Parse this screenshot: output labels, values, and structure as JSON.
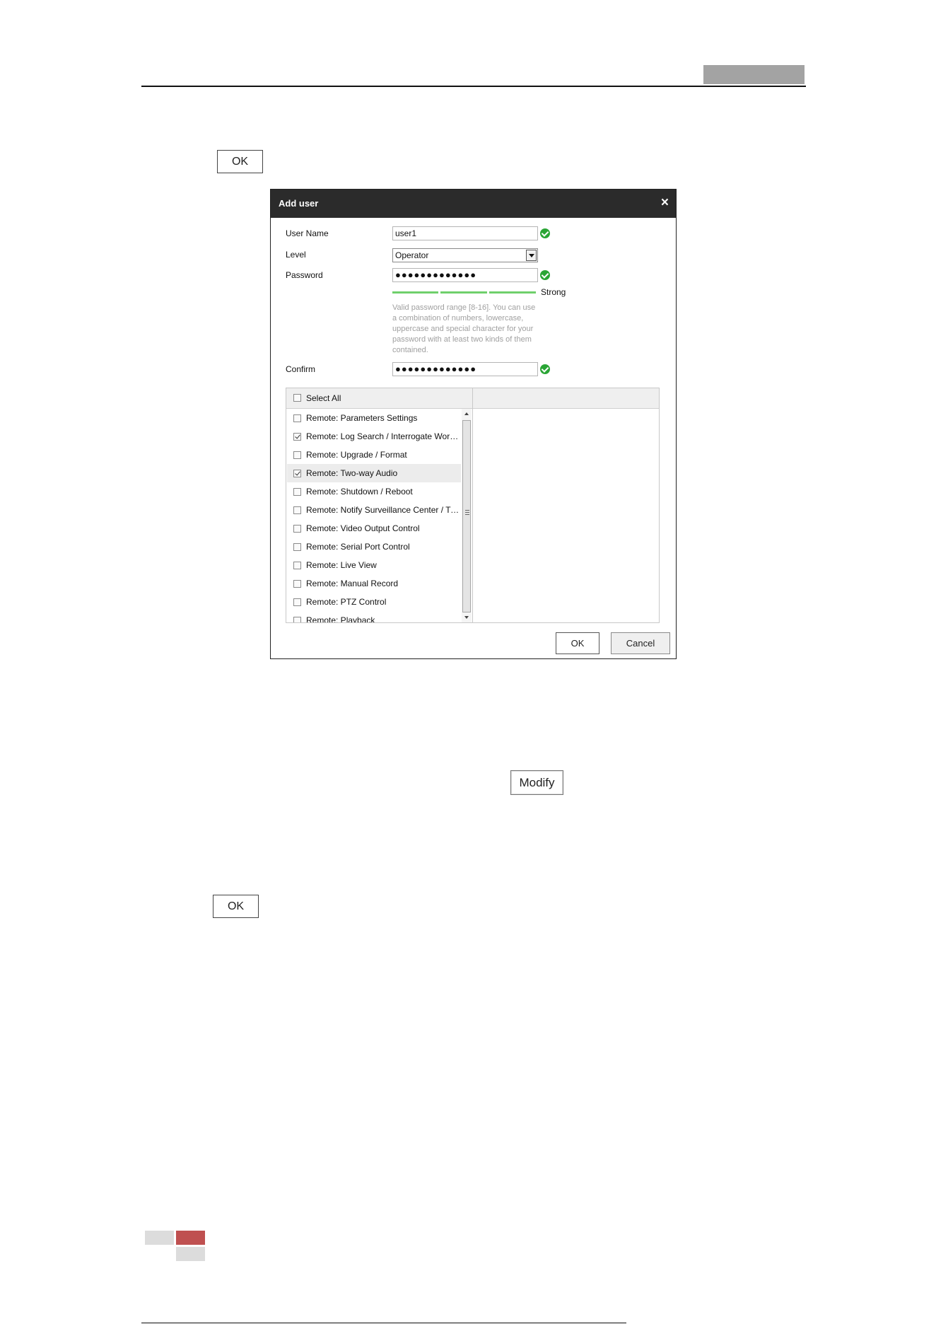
{
  "page": {
    "ok_top": "OK",
    "modify": "Modify",
    "ok_bottom": "OK"
  },
  "dialog": {
    "title": "Add user",
    "close_icon": "×",
    "fields": {
      "username_label": "User Name",
      "username_value": "user1",
      "level_label": "Level",
      "level_value": "Operator",
      "password_label": "Password",
      "password_value": "●●●●●●●●●●●●●",
      "strength": "Strong",
      "hint": "Valid password range [8-16]. You can use a combination of numbers, lowercase, uppercase and special character for your password with at least two kinds of them contained.",
      "confirm_label": "Confirm",
      "confirm_value": "●●●●●●●●●●●●●"
    },
    "select_all": "Select All",
    "permissions": [
      {
        "label": "Remote: Parameters Settings",
        "checked": false,
        "highlight": false
      },
      {
        "label": "Remote: Log Search / Interrogate Working Status",
        "checked": true,
        "highlight": false
      },
      {
        "label": "Remote: Upgrade / Format",
        "checked": false,
        "highlight": false
      },
      {
        "label": "Remote: Two-way Audio",
        "checked": true,
        "highlight": true
      },
      {
        "label": "Remote: Shutdown / Reboot",
        "checked": false,
        "highlight": false
      },
      {
        "label": "Remote: Notify Surveillance Center / Trigger Alarm Output",
        "checked": false,
        "highlight": false
      },
      {
        "label": "Remote: Video Output Control",
        "checked": false,
        "highlight": false
      },
      {
        "label": "Remote: Serial Port Control",
        "checked": false,
        "highlight": false
      },
      {
        "label": "Remote: Live View",
        "checked": false,
        "highlight": false
      },
      {
        "label": "Remote: Manual Record",
        "checked": false,
        "highlight": false
      },
      {
        "label": "Remote: PTZ Control",
        "checked": false,
        "highlight": false
      },
      {
        "label": "Remote: Playback",
        "checked": false,
        "highlight": false
      }
    ],
    "ok": "OK",
    "cancel": "Cancel"
  },
  "colors": {
    "titlebar": "#2b2b2b",
    "valid_icon": "#2aa535",
    "strength_bar": "#6fd06c",
    "footer_accent": "#bf5050"
  }
}
